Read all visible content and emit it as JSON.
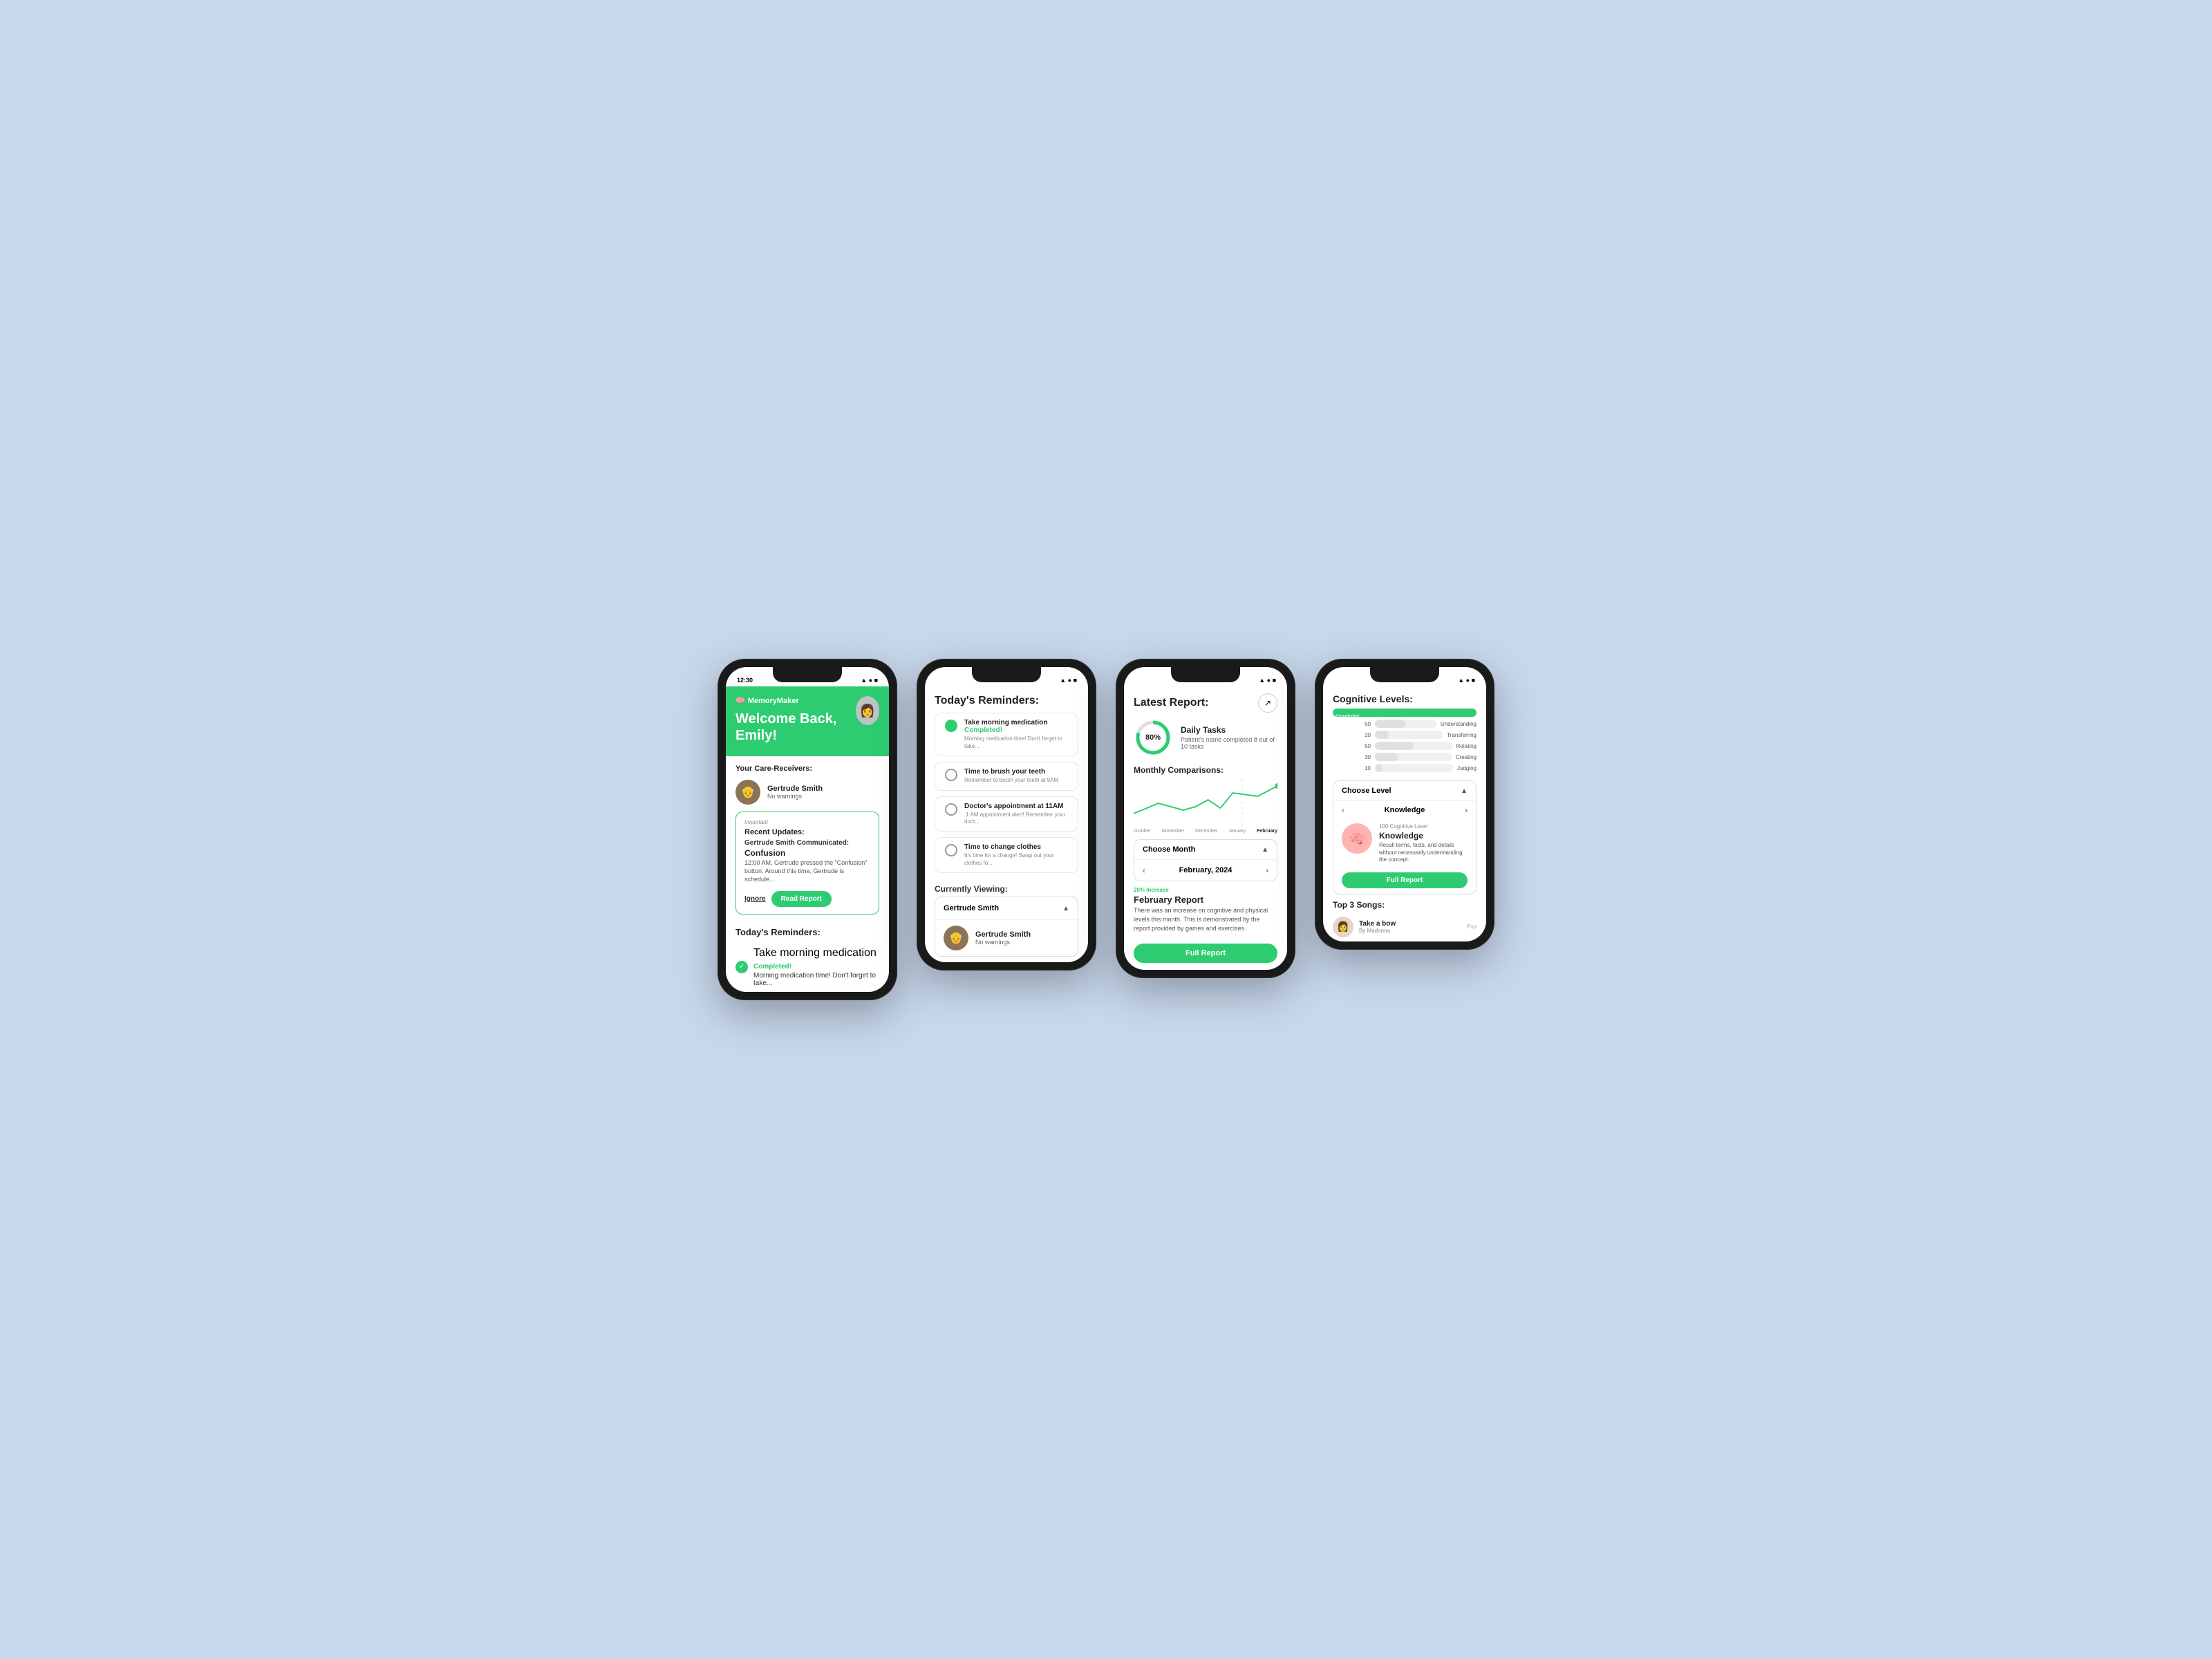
{
  "phone1": {
    "status_time": "12:30",
    "logo": "MemoryMaker",
    "welcome": "Welcome Back, Emily!",
    "section_care": "Your Care-Receivers:",
    "care_receiver": {
      "name": "Gertrude Smith",
      "status": "No warnings"
    },
    "important_label": "Important",
    "recent_updates_title": "Recent Updates:",
    "communicated": "Gertrude Smith Communicated:",
    "alert_title": "Confusion",
    "alert_desc": "12:00 AM, Gertrude pressed the \"Confusion\" button. Around this time, Gertrude is schedule...",
    "ignore_label": "Ignore",
    "read_label": "Read Report",
    "reminders_title": "Today's Reminders:",
    "reminder1_title": "Take morning medication",
    "reminder1_status": "Completed!",
    "reminder1_desc": "Morning medication time! Don't forget to take..."
  },
  "phone2": {
    "header": "Today's Reminders:",
    "reminders": [
      {
        "title": "Take morning medication",
        "desc": "Morning medication time! Don't forget to take...",
        "status": "Completed!",
        "completed": true
      },
      {
        "title": "Time to brush your teeth",
        "desc": "Remember to brush your teeth at 9AM",
        "status": "",
        "completed": false
      },
      {
        "title": "Doctor's appointment at 11AM",
        "desc": ":1 AM appointment alert! Remember your doct...",
        "status": "",
        "completed": false
      },
      {
        "title": "Time to change clothes",
        "desc": "It's time for a change! Swap out your clothes fo...",
        "status": "",
        "completed": false
      }
    ],
    "currently_viewing_label": "Currently Viewing:",
    "dropdown_label": "Gertrude Smith",
    "dropdown_person": {
      "name": "Gertrude Smith",
      "status": "No warnings"
    }
  },
  "phone3": {
    "header": "Latest Report:",
    "daily_title": "Daily Tasks",
    "daily_desc": "Patient's name completed 8 out of 10 tasks",
    "daily_progress": 80,
    "monthly_title": "Monthly Comparisons:",
    "chart_labels": [
      "October",
      "November",
      "December",
      "January",
      "February"
    ],
    "choose_month_label": "Choose Month",
    "month_nav": "February, 2024",
    "increase_label": "20% Increase",
    "report_title": "February Report",
    "report_desc": "There was an increase on cognitive and physical levels this month. This is demonstrated by the report provided by games and exercises.",
    "full_report_label": "Full Report"
  },
  "phone4": {
    "header": "Cognitive Levels:",
    "bars": [
      {
        "label": "Knowledge",
        "value": 100,
        "pct": 100
      },
      {
        "label": "Understanding",
        "value": 50,
        "pct": 50
      },
      {
        "label": "Transferring",
        "value": 20,
        "pct": 20
      },
      {
        "label": "Relating",
        "value": 50,
        "pct": 50
      },
      {
        "label": "Creating",
        "value": 30,
        "pct": 30
      },
      {
        "label": "Judging",
        "value": 10,
        "pct": 10
      }
    ],
    "choose_level_label": "Choose Level",
    "level_nav_label": "Knowledge",
    "level_cognitive_label": "100 Cognitive Level",
    "level_name": "Knowledge",
    "level_desc": "Recall terms, facts, and details without necessarily understanding the concept.",
    "full_report_label": "Full Report",
    "top_songs_label": "Top 3 Songs:",
    "songs": [
      {
        "title": "Take a bow",
        "artist": "By Madonna",
        "genre": "Pop"
      }
    ]
  }
}
